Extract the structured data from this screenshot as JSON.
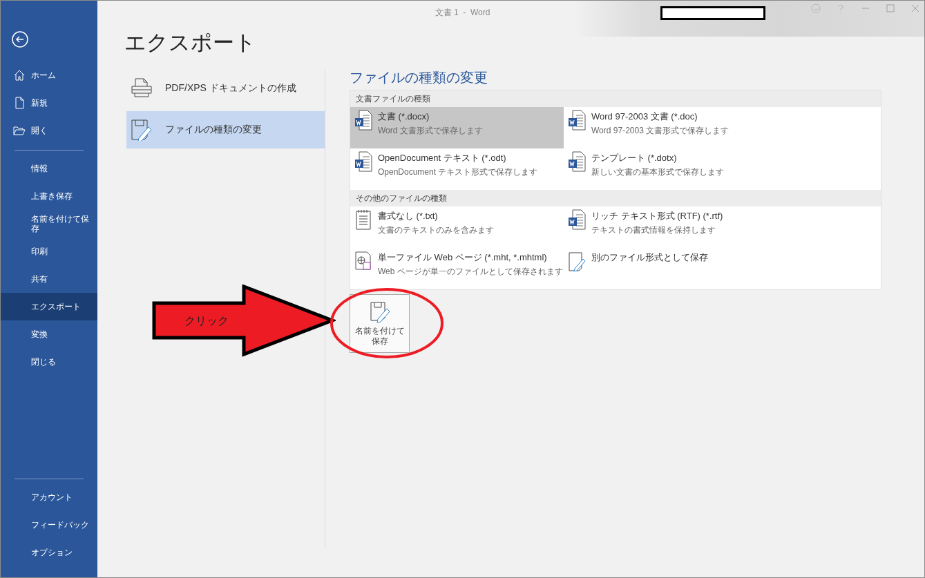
{
  "window": {
    "title": "文書 1  -  Word"
  },
  "sidebar": {
    "top_items": [
      {
        "label": "ホーム",
        "selected": false
      },
      {
        "label": "新規",
        "selected": false
      },
      {
        "label": "開く",
        "selected": false
      }
    ],
    "items": [
      {
        "label": "情報",
        "selected": false
      },
      {
        "label": "上書き保存",
        "selected": false
      },
      {
        "label": "名前を付けて保存",
        "selected": false
      },
      {
        "label": "印刷",
        "selected": false
      },
      {
        "label": "共有",
        "selected": false
      },
      {
        "label": "エクスポート",
        "selected": true
      },
      {
        "label": "変換",
        "selected": false
      },
      {
        "label": "閉じる",
        "selected": false
      }
    ],
    "bottom_items": [
      {
        "label": "アカウント",
        "selected": false
      },
      {
        "label": "フィードバック",
        "selected": false
      },
      {
        "label": "オプション",
        "selected": false
      }
    ]
  },
  "page_title": "エクスポート",
  "export_options": [
    {
      "label": "PDF/XPS ドキュメントの作成",
      "kind": "pdf",
      "selected": false
    },
    {
      "label": "ファイルの種類の変更",
      "kind": "change",
      "selected": true
    }
  ],
  "file_types": {
    "title": "ファイルの種類の変更",
    "sections": [
      {
        "title": "文書ファイルの種類",
        "items": [
          {
            "kind": "word",
            "title": "文書 (*.docx)",
            "description": "Word 文書形式で保存します",
            "selected": true
          },
          {
            "kind": "word",
            "title": "Word 97-2003 文書 (*.doc)",
            "description": "Word 97-2003 文書形式で保存します",
            "selected": false
          },
          {
            "kind": "word",
            "title": "OpenDocument テキスト (*.odt)",
            "description": "OpenDocument テキスト形式で保存します",
            "selected": false
          },
          {
            "kind": "word",
            "title": "テンプレート (*.dotx)",
            "description": "新しい文書の基本形式で保存します",
            "selected": false
          }
        ]
      },
      {
        "title": "その他のファイルの種類",
        "items": [
          {
            "kind": "text",
            "title": "書式なし (*.txt)",
            "description": "文書のテキストのみを含みます",
            "selected": false
          },
          {
            "kind": "word",
            "title": "リッチ テキスト形式 (RTF) (*.rtf)",
            "description": "テキストの書式情報を保持します",
            "selected": false
          },
          {
            "kind": "web",
            "title": "単一ファイル Web ページ (*.mht, *.mhtml)",
            "description": "Web ページが単一のファイルとして保存されます",
            "selected": false
          },
          {
            "kind": "other",
            "title": "別のファイル形式として保存",
            "selected": false
          }
        ]
      }
    ],
    "save_button": "名前を付けて保存"
  },
  "annotation": {
    "arrow_label": "クリック"
  }
}
